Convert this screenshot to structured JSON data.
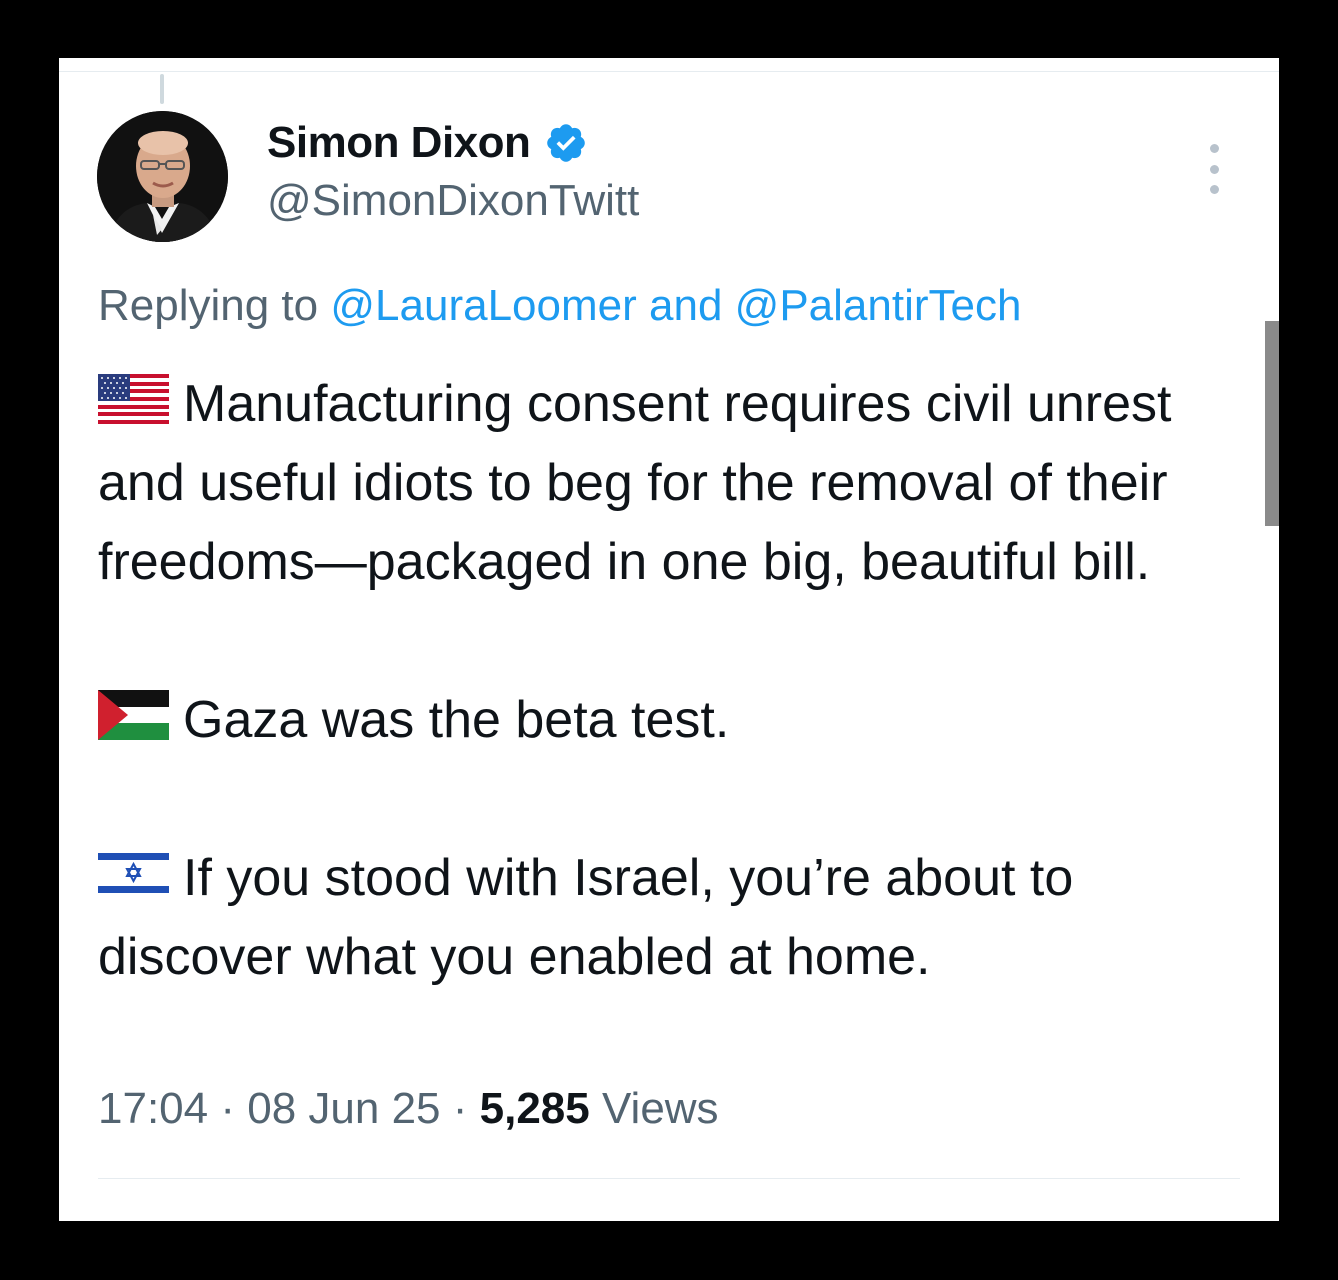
{
  "author": {
    "display_name": "Simon Dixon",
    "handle": "@SimonDixonTwitt",
    "verified": true,
    "avatar_icon": "user-avatar-photo"
  },
  "reply": {
    "prefix": "Replying to",
    "mention1": "@LauraLoomer",
    "conjunction": "and",
    "mention2": "@PalantirTech"
  },
  "tweet": {
    "paragraphs": [
      {
        "flag_icon": "us-flag-icon",
        "text": "Manufacturing consent requires civil unrest and useful idiots to beg for the removal of their freedoms—packaged in one big, beautiful bill."
      },
      {
        "flag_icon": "palestine-flag-icon",
        "text": "Gaza was the beta test."
      },
      {
        "flag_icon": "israel-flag-icon",
        "text": "If you stood with Israel, you’re about to discover what you enabled at home."
      }
    ]
  },
  "meta": {
    "time": "17:04",
    "separator": "·",
    "date": "08 Jun 25",
    "views_count": "5,285",
    "views_label": "Views"
  },
  "colors": {
    "accent": "#1d9bf0",
    "text_primary": "#0f1419",
    "text_secondary": "#536471"
  }
}
